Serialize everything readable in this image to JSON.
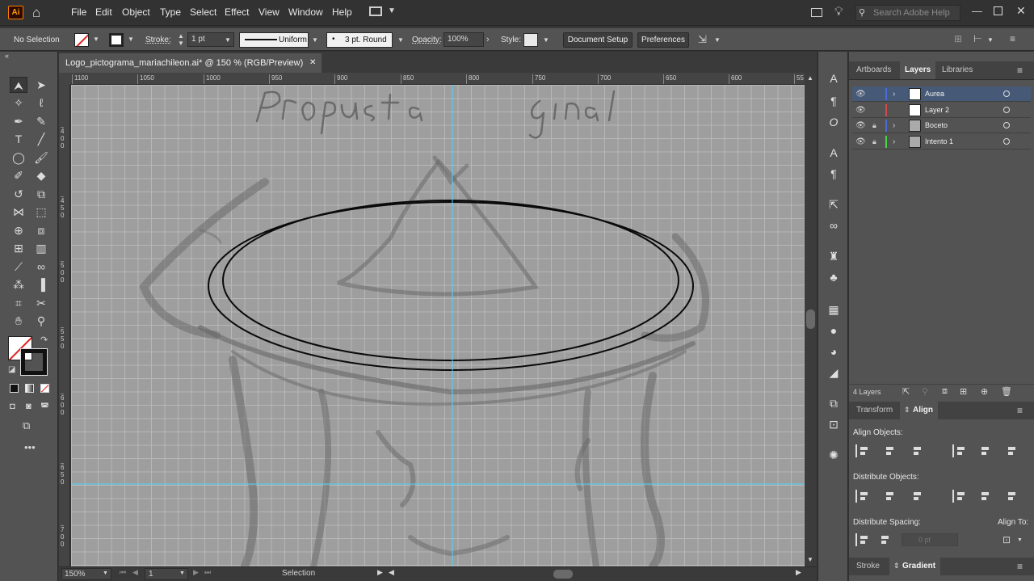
{
  "app": {
    "logo": "Ai"
  },
  "menu": [
    "File",
    "Edit",
    "Object",
    "Type",
    "Select",
    "Effect",
    "View",
    "Window",
    "Help"
  ],
  "search": {
    "placeholder": "Search Adobe Help"
  },
  "control": {
    "selection": "No Selection",
    "stroke_label": "Stroke:",
    "stroke_value": "1 pt",
    "stroke_profile": "Uniform",
    "brush": "3 pt. Round",
    "opacity_label": "Opacity:",
    "opacity_value": "100%",
    "style_label": "Style:",
    "doc_setup": "Document Setup",
    "preferences": "Preferences"
  },
  "document": {
    "tab_title": "Logo_pictograma_mariachileon.ai* @ 150 % (RGB/Preview)",
    "close": "✕"
  },
  "ruler": {
    "top": [
      "1100",
      "1050",
      "1000",
      "950",
      "900",
      "850",
      "800",
      "750",
      "700",
      "650",
      "600",
      "55"
    ],
    "left": [
      "4\n0\n0",
      "4\n5\n0",
      "5\n0\n0",
      "5\n5\n0",
      "6\n0\n0",
      "6\n5\n0",
      "7\n0\n0"
    ]
  },
  "sketch_text": "Propuesta final",
  "status": {
    "zoom": "150%",
    "artboard": "1",
    "mode": "Selection"
  },
  "panels": {
    "tabs": [
      "Artboards",
      "Layers",
      "Libraries"
    ],
    "active_tab": "Layers",
    "layers": [
      {
        "name": "Aurea",
        "color": "#4a6cd4",
        "locked": false,
        "selected": true
      },
      {
        "name": "Layer 2",
        "color": "#d44a4a",
        "locked": false,
        "selected": false
      },
      {
        "name": "Boceto",
        "color": "#4a6cd4",
        "locked": true,
        "selected": false
      },
      {
        "name": "Intento 1",
        "color": "#4ad44a",
        "locked": true,
        "selected": false
      }
    ],
    "layer_count": "4 Layers",
    "lower_tabs": [
      "Transform",
      "Align"
    ],
    "align_objects": "Align Objects:",
    "distribute_objects": "Distribute Objects:",
    "distribute_spacing": "Distribute Spacing:",
    "align_to": "Align To:",
    "spacing_value": "0 pt",
    "bottom_tabs": [
      "Stroke",
      "Gradient"
    ]
  },
  "colors": {
    "accent": "#4fd6ff",
    "selected_row": "#465a78",
    "stroke_red": "#e02020"
  }
}
